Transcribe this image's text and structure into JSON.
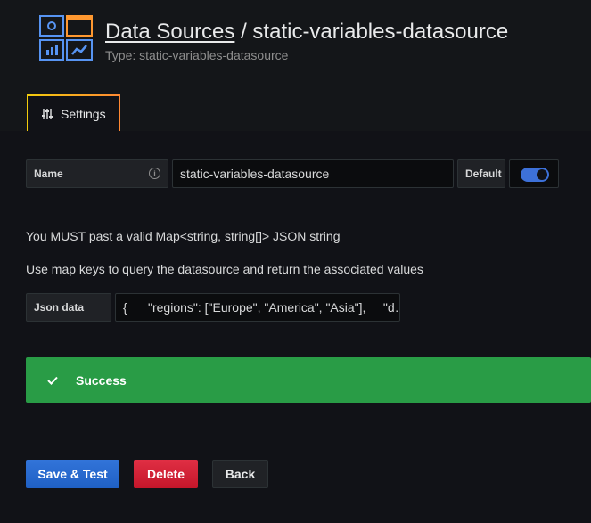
{
  "header": {
    "breadcrumb_link": "Data Sources",
    "separator": " / ",
    "title": "static-variables-datasource",
    "subtitle": "Type: static-variables-datasource"
  },
  "tabs": [
    {
      "label": "Settings",
      "icon": "sliders-icon"
    }
  ],
  "form": {
    "name_label": "Name",
    "name_value": "static-variables-datasource",
    "default_label": "Default",
    "default_enabled": true,
    "json_label": "Json data",
    "json_value": "{      \"regions\": [\"Europe\", \"America\", \"Asia\"],     \"d…"
  },
  "help": {
    "line1": "You MUST past a valid Map<string, string[]> JSON string",
    "line2": "Use map keys to query the datasource and return the associated values"
  },
  "alert": {
    "text": "Success",
    "icon": "check-icon",
    "color": "#299c46"
  },
  "buttons": {
    "save": "Save & Test",
    "delete": "Delete",
    "back": "Back"
  },
  "colors": {
    "primary": "#3274d9",
    "danger": "#e02f44",
    "success": "#299c46"
  }
}
